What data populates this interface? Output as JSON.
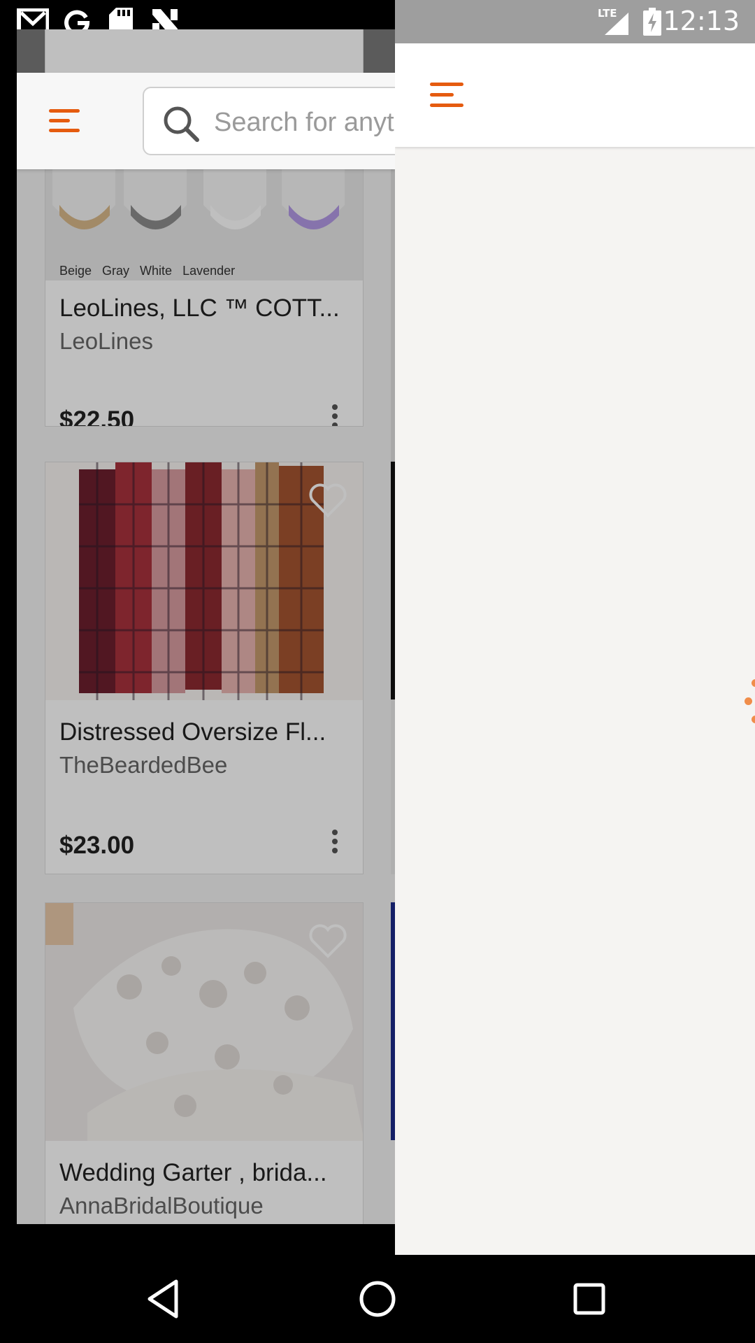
{
  "status_bar": {
    "time": "12:13",
    "network": "LTE",
    "left_icons": [
      "gmail-icon",
      "google-icon",
      "sd-card-icon",
      "n-app-icon"
    ],
    "right_icons": [
      "signal-icon",
      "battery-charging-icon"
    ]
  },
  "background_app": {
    "search_placeholder": "Search for anyt",
    "listings": [
      {
        "title": "LeoLines, LLC ™ COTT...",
        "shop": "LeoLines",
        "price": "$22.50",
        "image_caption": "Beige   Gray   White   Lavender"
      },
      {
        "title": "Distressed Oversize Fl...",
        "shop": "TheBeardedBee",
        "price": "$23.00"
      },
      {
        "title": "Wedding Garter , brida...",
        "shop": "AnnaBridalBoutique"
      }
    ]
  },
  "drawer_panel": {
    "menu_icon": "hamburger-menu-icon",
    "state": "loading"
  },
  "nav_bar": {
    "buttons": [
      "back-button",
      "home-button",
      "recents-button"
    ]
  },
  "colors": {
    "accent": "#e55b0f",
    "panel_bg": "#f5f4f2",
    "status_bar_right": "#9e9e9e"
  }
}
